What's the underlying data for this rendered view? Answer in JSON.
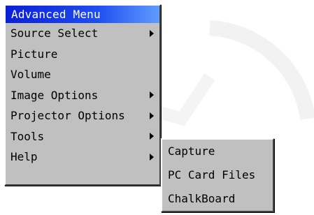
{
  "menu": {
    "title": "Advanced Menu",
    "items": [
      {
        "label": "Source Select",
        "has_submenu": true
      },
      {
        "label": "Picture",
        "has_submenu": false
      },
      {
        "label": "Volume",
        "has_submenu": false
      },
      {
        "label": "Image Options",
        "has_submenu": true
      },
      {
        "label": "Projector Options",
        "has_submenu": true
      },
      {
        "label": "Tools",
        "has_submenu": true
      },
      {
        "label": "Help",
        "has_submenu": true
      }
    ]
  },
  "submenu": {
    "parent": "Tools",
    "items": [
      {
        "label": "Capture"
      },
      {
        "label": "PC Card Files"
      },
      {
        "label": "ChalkBoard"
      }
    ]
  },
  "colors": {
    "menu_bg": "#c0c0c0",
    "title_gradient_start": "#0a1fd8",
    "title_gradient_end": "#5f9bff",
    "title_text": "#ffffff"
  }
}
